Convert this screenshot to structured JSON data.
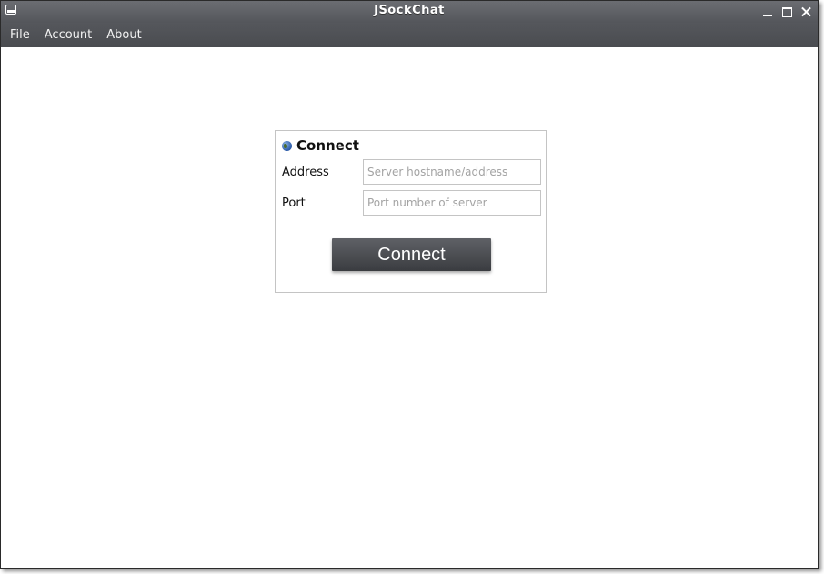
{
  "window": {
    "title": "JSockChat"
  },
  "menu": {
    "items": [
      "File",
      "Account",
      "About"
    ]
  },
  "connect_panel": {
    "title": "Connect",
    "address_label": "Address",
    "address_placeholder": "Server hostname/address",
    "address_value": "",
    "port_label": "Port",
    "port_placeholder": "Port number of server",
    "port_value": "",
    "button_label": "Connect"
  },
  "icons": {
    "system": "window-icon",
    "minimize": "minimize-icon",
    "maximize": "maximize-icon",
    "close": "close-icon",
    "panel": "globe-icon"
  },
  "colors": {
    "titlebar": "#5f6166",
    "menubar": "#505256",
    "button": "#4a4c50",
    "panel_border": "#c4c4c4"
  }
}
